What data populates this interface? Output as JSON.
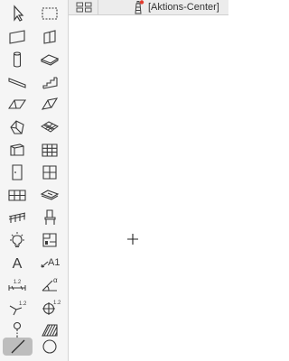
{
  "header": {
    "action_center_label": "[Aktions-Center]"
  },
  "toolbox": {
    "active_tool": "line-tool",
    "colors": {
      "stroke": "#3a3a3a",
      "active_bg": "#bdbdbd",
      "badge": "#e23b2e"
    },
    "tool_labels": {
      "label_text": "A",
      "dimension_label": "A1",
      "angle_label": "α",
      "dim_value": "1.2"
    }
  }
}
